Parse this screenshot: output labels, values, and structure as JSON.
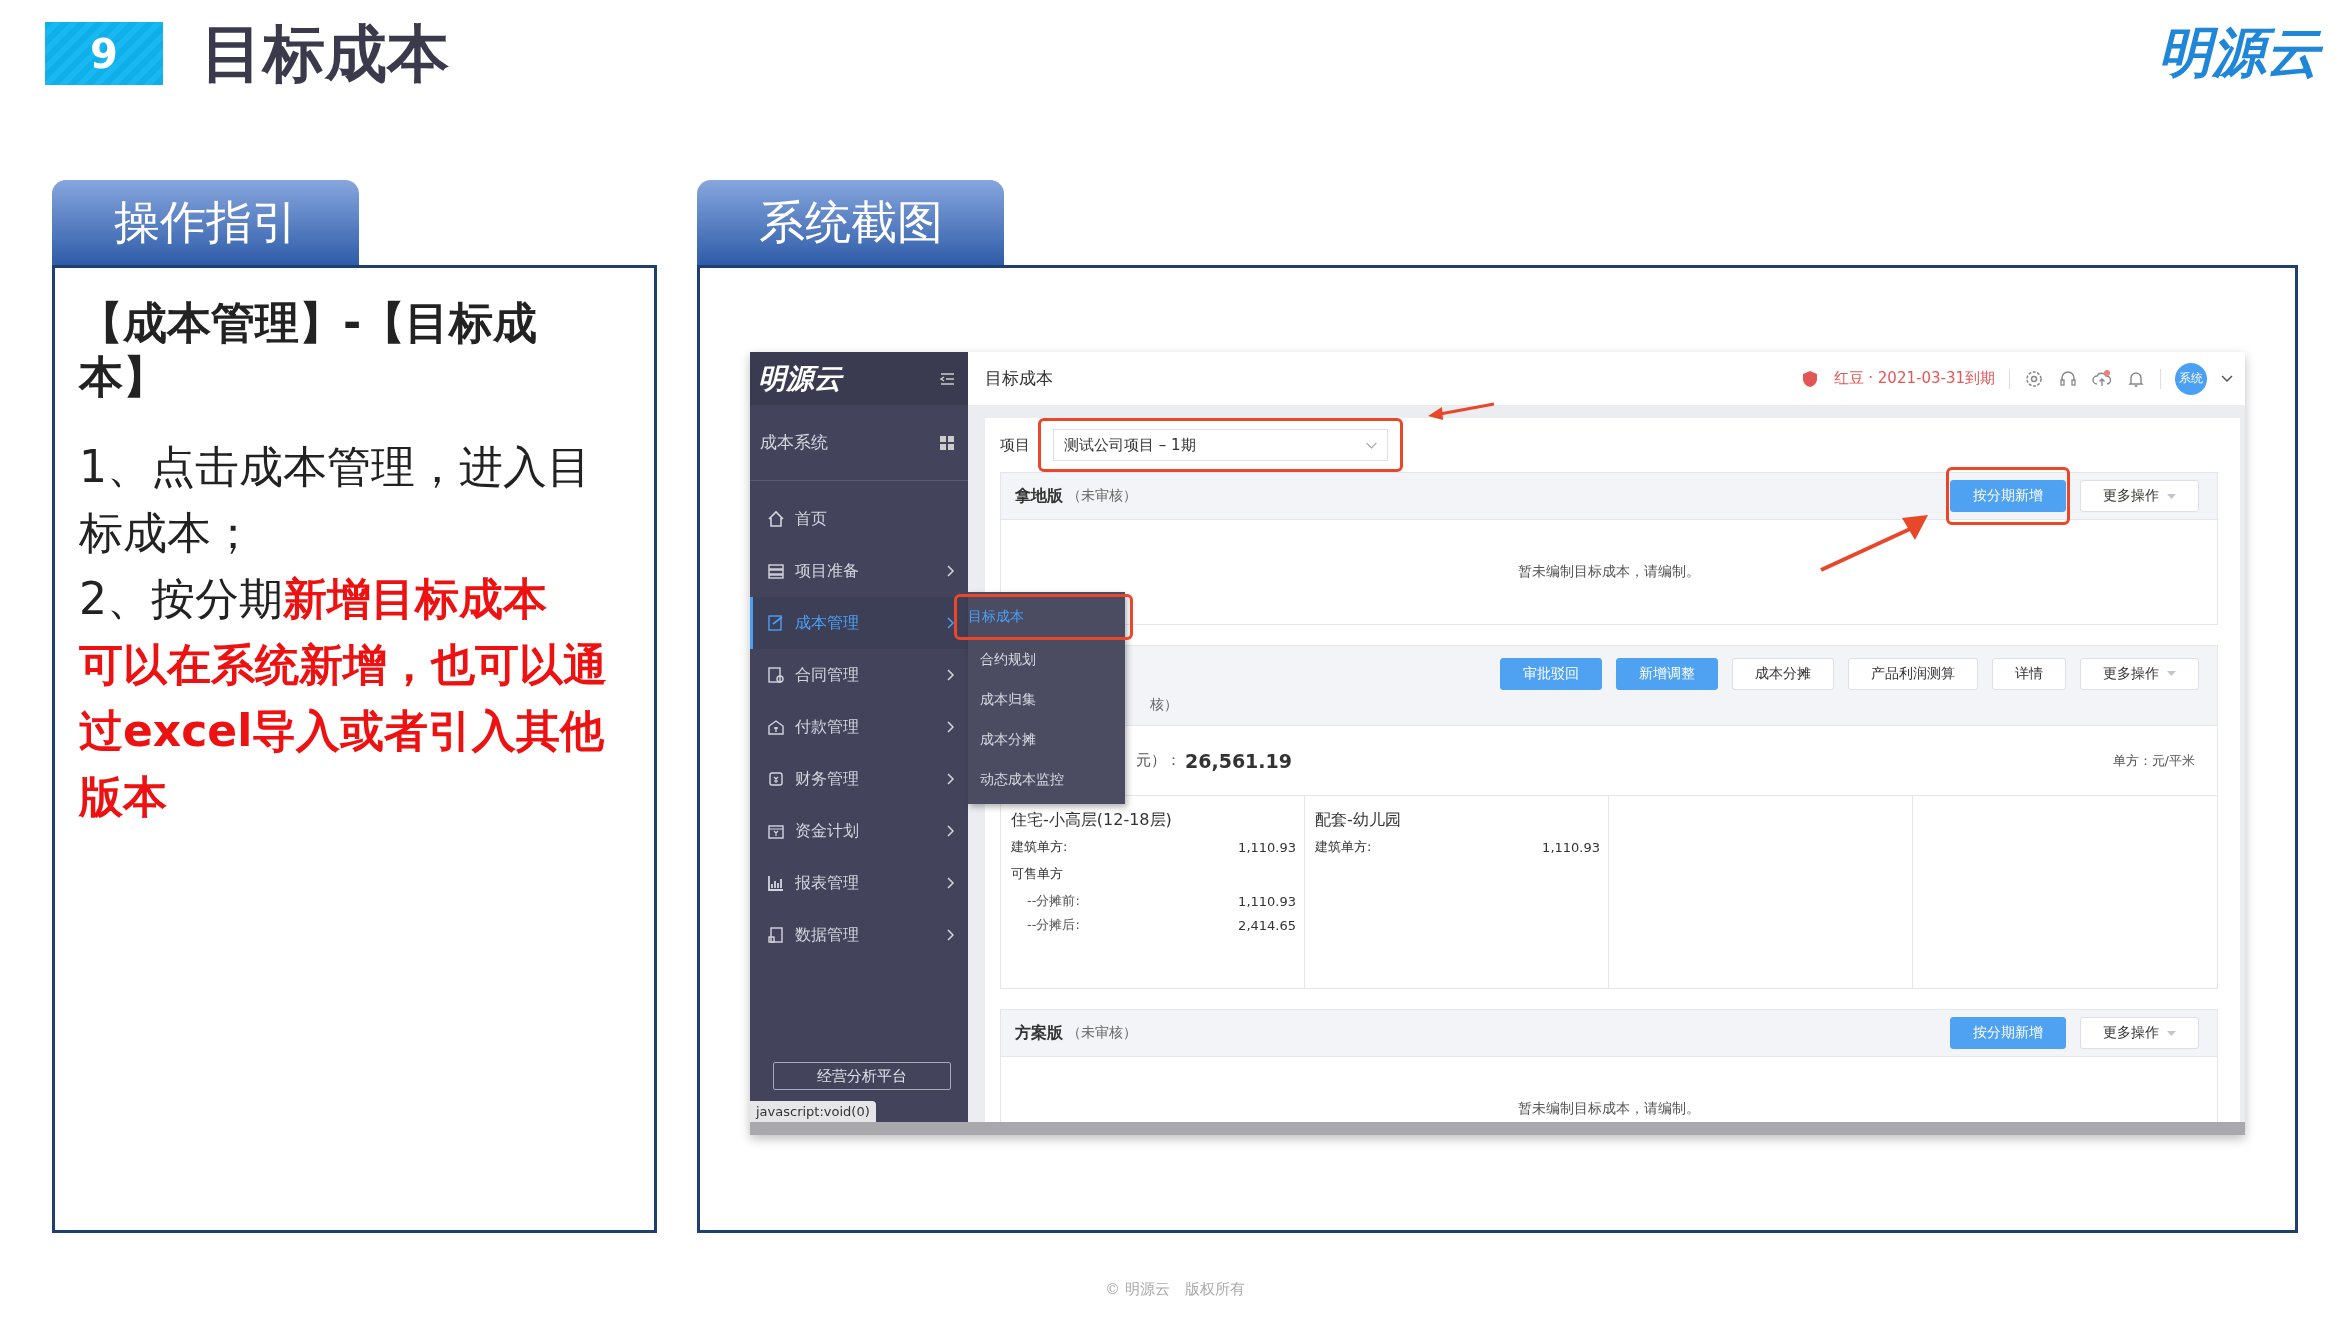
{
  "slide": {
    "number": "9",
    "title": "目标成本",
    "logo": "明源云"
  },
  "guide": {
    "tab": "操作指引",
    "heading": "【成本管理】-【目标成本】",
    "steps": [
      "1、点击成本管理，进入目标成本；",
      "2、按分期**新增目标成本**"
    ],
    "note": "可以在系统新增，也可以通过excel导入或者引入其他版本"
  },
  "screenshot": {
    "tab": "系统截图",
    "sidebar": {
      "logo": "明源云",
      "system": "成本系统",
      "items": [
        {
          "label": "首页",
          "selected": false,
          "expandable": false
        },
        {
          "label": "项目准备",
          "selected": false,
          "expandable": true
        },
        {
          "label": "成本管理",
          "selected": true,
          "expandable": true
        },
        {
          "label": "合同管理",
          "selected": false,
          "expandable": true
        },
        {
          "label": "付款管理",
          "selected": false,
          "expandable": true
        },
        {
          "label": "财务管理",
          "selected": false,
          "expandable": true
        },
        {
          "label": "资金计划",
          "selected": false,
          "expandable": true
        },
        {
          "label": "报表管理",
          "selected": false,
          "expandable": true
        },
        {
          "label": "数据管理",
          "selected": false,
          "expandable": true
        }
      ],
      "platform_button": "经营分析平台"
    },
    "submenu": [
      {
        "label": "目标成本",
        "selected": true,
        "highlighted": true
      },
      {
        "label": "合约规划",
        "selected": false,
        "highlighted": false
      },
      {
        "label": "成本归集",
        "selected": false,
        "highlighted": false
      },
      {
        "label": "成本分摊",
        "selected": false,
        "highlighted": false
      },
      {
        "label": "动态成本监控",
        "selected": false,
        "highlighted": false
      }
    ],
    "topbar": {
      "title": "目标成本",
      "expiry": "红豆 · 2021-03-31到期",
      "avatar": "系统"
    },
    "project": {
      "label": "项目",
      "value": "测试公司项目 – 1期",
      "highlighted": true
    },
    "sections": [
      {
        "kind": "empty",
        "title": "拿地版",
        "status": "（未审核）",
        "buttons": [
          {
            "label": "按分期新增",
            "primary": true,
            "dropdown": false,
            "highlighted": true
          },
          {
            "label": "更多操作",
            "primary": false,
            "dropdown": true,
            "highlighted": false
          }
        ],
        "message": "暂未编制目标成本，请编制。"
      },
      {
        "kind": "summary",
        "status": "核）",
        "buttons": [
          {
            "label": "审批驳回",
            "primary": true,
            "dropdown": false,
            "highlighted": false
          },
          {
            "label": "新增调整",
            "primary": true,
            "dropdown": false,
            "highlighted": false
          },
          {
            "label": "成本分摊",
            "primary": false,
            "dropdown": false,
            "highlighted": false
          },
          {
            "label": "产品利润测算",
            "primary": false,
            "dropdown": false,
            "highlighted": false
          },
          {
            "label": "详情",
            "primary": false,
            "dropdown": false,
            "highlighted": false
          },
          {
            "label": "更多操作",
            "primary": false,
            "dropdown": true,
            "highlighted": false
          }
        ],
        "total_label": "元）：",
        "total": "26,561.19",
        "unit": "单方：元/平米",
        "products": [
          {
            "name": "住宅-小高层(12-18层)",
            "rows": [
              {
                "kind": "main",
                "label": "建筑单方:",
                "value": "1,110.93"
              },
              {
                "kind": "group",
                "label": "可售单方"
              },
              {
                "kind": "sub",
                "label": "--分摊前:",
                "value": "1,110.93"
              },
              {
                "kind": "sub",
                "label": "--分摊后:",
                "value": "2,414.65"
              }
            ]
          },
          {
            "name": "配套-幼儿园",
            "rows": [
              {
                "kind": "main",
                "label": "建筑单方:",
                "value": "1,110.93"
              }
            ]
          }
        ]
      },
      {
        "kind": "empty",
        "title": "方案版",
        "status": "（未审核）",
        "buttons": [
          {
            "label": "按分期新增",
            "primary": true,
            "dropdown": false,
            "highlighted": false
          },
          {
            "label": "更多操作",
            "primary": false,
            "dropdown": true,
            "highlighted": false
          }
        ],
        "message": "暂未编制目标成本，请编制。"
      }
    ],
    "status_tip": "javascript:void(0)"
  },
  "footer": "© 明源云　版权所有"
}
